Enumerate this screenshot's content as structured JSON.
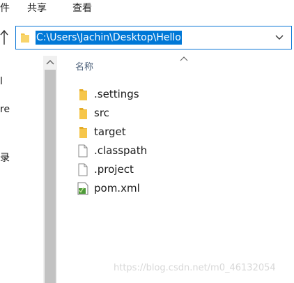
{
  "ribbon": {
    "tabs": [
      {
        "label": "件"
      },
      {
        "label": "共享"
      },
      {
        "label": "查看"
      }
    ]
  },
  "address_bar": {
    "path": "C:\\Users\\Jachin\\Desktop\\Hello"
  },
  "nav_pane": {
    "fragments": [
      "l",
      "re",
      "录"
    ]
  },
  "content": {
    "column_header": "名称",
    "files": [
      {
        "name": ".settings",
        "icon": "folder-icon"
      },
      {
        "name": "src",
        "icon": "folder-icon"
      },
      {
        "name": "target",
        "icon": "folder-icon"
      },
      {
        "name": ".classpath",
        "icon": "file-icon"
      },
      {
        "name": ".project",
        "icon": "file-icon"
      },
      {
        "name": "pom.xml",
        "icon": "xml-file-icon"
      }
    ]
  },
  "watermark": "https://blog.csdn.net/m0_46132054",
  "colors": {
    "accent": "#0078d7",
    "folder": "#f6c64a",
    "selection_text": "#ffffff"
  }
}
